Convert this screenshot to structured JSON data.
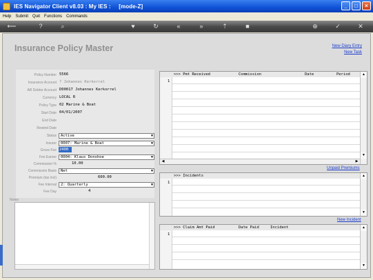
{
  "window": {
    "title": "IES Navigator Client v8.03 : My IES :     [mode-Z]"
  },
  "menu": [
    "Help",
    "Submit",
    "Quit",
    "Functions",
    "Commands"
  ],
  "toolbar_icons": [
    "back-icon",
    "help-icon",
    "search-icon",
    "heart-icon",
    "refresh-icon",
    "first-icon",
    "last-icon",
    "up-icon",
    "down-icon",
    "add-icon",
    "check-icon",
    "close-icon"
  ],
  "page": {
    "title": "Insurance Policy Master"
  },
  "links": {
    "new_diary": "New Diary Entry",
    "new_task": "New Task",
    "unpaid_premiums": "Unpaid Premiums",
    "new_incident": "New Incident"
  },
  "fields": {
    "policy_number": {
      "label": "Policy Number",
      "value": "5566"
    },
    "insurance_account": {
      "label": "Insurance Account",
      "value": "? Johannes Kerkorrel"
    },
    "ar_debtor_account": {
      "label": "AR Debtor Account",
      "value": "D00017 Johannes Kerkorrel"
    },
    "currency": {
      "label": "Currency",
      "value": "LOCAL R"
    },
    "policy_type": {
      "label": "Policy Type",
      "value": "02 Marine & Boat"
    },
    "start_date": {
      "label": "Start Date",
      "value": "04/01/2007"
    },
    "end_date": {
      "label": "End Date",
      "value": ""
    },
    "rewind_date": {
      "label": "Rewind Date",
      "value": ""
    },
    "status": {
      "label": "Status",
      "value": "Active"
    },
    "insurer": {
      "label": "Insurer",
      "value": "0007: Marine & Boat"
    },
    "gross_fee": {
      "label": "Gross Fee",
      "value": "2400"
    },
    "fee_earner": {
      "label": "Fee Earner",
      "value": "0004: Klaus Donohoe"
    },
    "commission_pct": {
      "label": "Commission %",
      "value": "10.00"
    },
    "commission_basis": {
      "label": "Commission Basis",
      "value": "Net"
    },
    "premium": {
      "label": "Premium (tax incl)",
      "value": "600.00"
    },
    "fee_interval": {
      "label": "Fee Interval",
      "value": "2: Quarterly"
    },
    "fee_day": {
      "label": "Fee Day",
      "value": "4"
    }
  },
  "notes": {
    "label": "Notes"
  },
  "grids": {
    "received": {
      "headers": [
        ">>> Pmt Received",
        "Commission",
        "Date",
        "Period"
      ],
      "row_num": "1"
    },
    "incidents": {
      "headers": [
        ">>> Incidents"
      ],
      "row_num": "1"
    },
    "claims": {
      "headers": [
        ">>> Claim Amt Paid",
        "Date Paid",
        "Incident"
      ],
      "row_num": "1"
    }
  }
}
